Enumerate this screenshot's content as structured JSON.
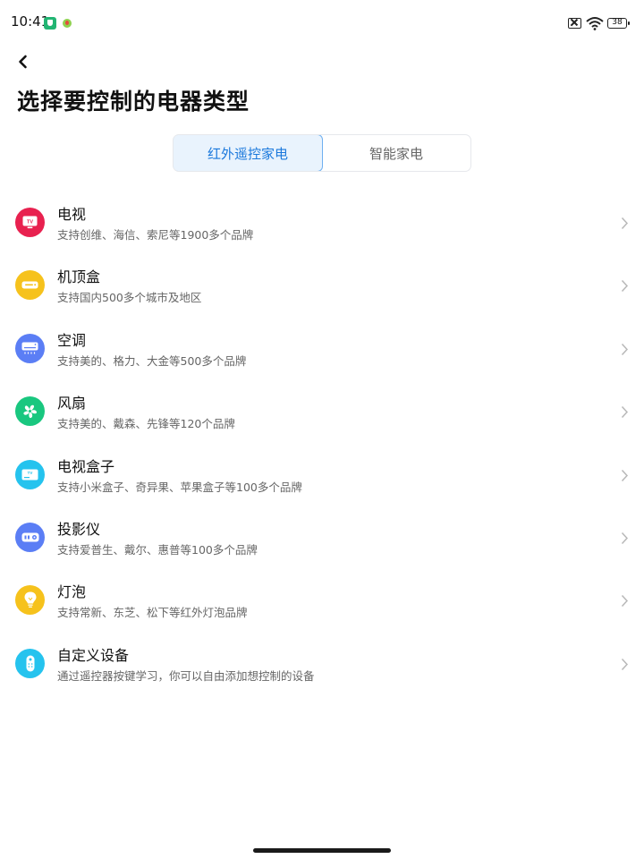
{
  "status_bar": {
    "time": "10:41",
    "battery": "38"
  },
  "header": {
    "title": "选择要控制的电器类型"
  },
  "tabs": [
    {
      "label": "红外遥控家电",
      "active": true
    },
    {
      "label": "智能家电",
      "active": false
    }
  ],
  "devices": [
    {
      "name": "电视",
      "desc": "支持创维、海信、索尼等1900多个品牌",
      "icon": "tv-icon",
      "color": "#e8214f"
    },
    {
      "name": "机顶盒",
      "desc": "支持国内500多个城市及地区",
      "icon": "set-top-box-icon",
      "color": "#f6c21c"
    },
    {
      "name": "空调",
      "desc": "支持美的、格力、大金等500多个品牌",
      "icon": "air-conditioner-icon",
      "color": "#5b7ef5"
    },
    {
      "name": "风扇",
      "desc": "支持美的、戴森、先锋等120个品牌",
      "icon": "fan-icon",
      "color": "#19c77f"
    },
    {
      "name": "电视盒子",
      "desc": "支持小米盒子、奇异果、苹果盒子等100多个品牌",
      "icon": "tv-box-icon",
      "color": "#25c3ee"
    },
    {
      "name": "投影仪",
      "desc": "支持爱普生、戴尔、惠普等100多个品牌",
      "icon": "projector-icon",
      "color": "#5b7ef5"
    },
    {
      "name": "灯泡",
      "desc": "支持常新、东芝、松下等红外灯泡品牌",
      "icon": "light-bulb-icon",
      "color": "#f6c21c"
    },
    {
      "name": "自定义设备",
      "desc": "通过遥控器按键学习，你可以自由添加想控制的设备",
      "icon": "remote-control-icon",
      "color": "#25c3ee"
    }
  ],
  "accent_color": "#1a78dc"
}
